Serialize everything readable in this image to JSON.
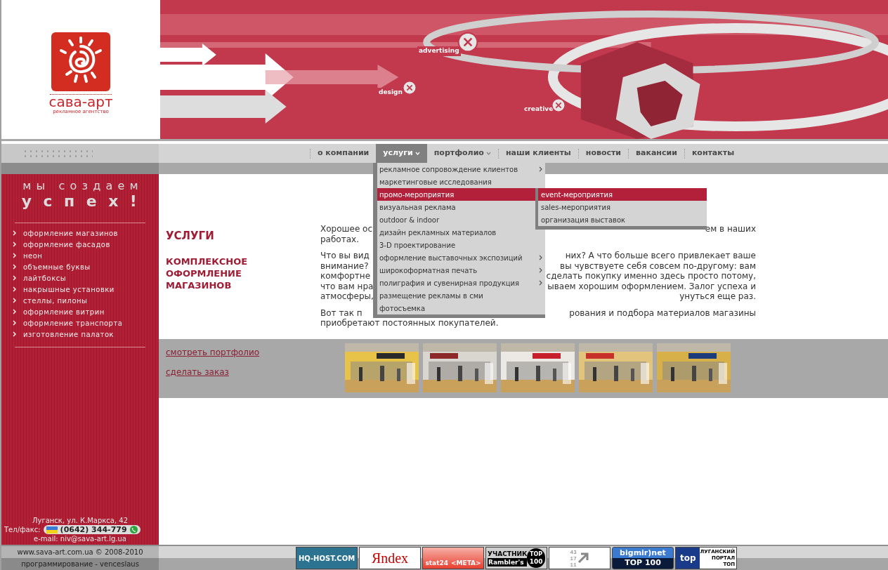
{
  "logo": {
    "name": "сава-арт",
    "tagline": "рекламное агентство"
  },
  "banner": {
    "labels": [
      {
        "text": "advertising"
      },
      {
        "text": "design"
      },
      {
        "text": "creative"
      }
    ]
  },
  "nav": [
    {
      "label": "о компании",
      "selected": false,
      "has_submenu": false
    },
    {
      "label": "услуги",
      "selected": true,
      "has_submenu": true
    },
    {
      "label": "портфолио",
      "selected": false,
      "has_submenu": true
    },
    {
      "label": "наши клиенты",
      "selected": false,
      "has_submenu": false
    },
    {
      "label": "новости",
      "selected": false,
      "has_submenu": false
    },
    {
      "label": "вакансии",
      "selected": false,
      "has_submenu": false
    },
    {
      "label": "контакты",
      "selected": false,
      "has_submenu": false
    }
  ],
  "dropdown": [
    {
      "label": "рекламное сопровождение клиентов",
      "selected": false,
      "has_submenu": true
    },
    {
      "label": "маркетинговые исследования",
      "selected": false,
      "has_submenu": false
    },
    {
      "label": "промо-мероприятия",
      "selected": true,
      "has_submenu": true,
      "children": [
        {
          "label": "event-мероприятия",
          "selected": true
        },
        {
          "label": "sales-мероприятия",
          "selected": false
        },
        {
          "label": "организация выставок",
          "selected": false
        }
      ]
    },
    {
      "label": "визуальная реклама",
      "selected": false,
      "has_submenu": false
    },
    {
      "label": "outdoor & indoor",
      "selected": false,
      "has_submenu": false
    },
    {
      "label": "дизайн рекламных материалов",
      "selected": false,
      "has_submenu": false
    },
    {
      "label": "3-D проектирование",
      "selected": false,
      "has_submenu": false
    },
    {
      "label": "оформление выставочных экспозиций",
      "selected": false,
      "has_submenu": true
    },
    {
      "label": "широкоформатная печать",
      "selected": false,
      "has_submenu": true
    },
    {
      "label": "полиграфия и сувенирная продукция",
      "selected": false,
      "has_submenu": true
    },
    {
      "label": "размещение рекламы в сми",
      "selected": false,
      "has_submenu": false
    },
    {
      "label": "фотосъемка",
      "selected": false,
      "has_submenu": false
    }
  ],
  "sidebar": {
    "slogan_top": "мы создаем",
    "slogan_bottom": "успех!",
    "items": [
      "оформление магазинов",
      "оформление фасадов",
      "неон",
      "объемные буквы",
      "лайтбоксы",
      "накрышные установки",
      "стеллы, пилоны",
      "оформление витрин",
      "оформление транспорта",
      "изготовление палаток"
    ],
    "address": "Луганск, ул. К.Маркса, 42",
    "phone_label": "Тел/факс:",
    "phone": "(0642) 344-779",
    "email": "e-mail: niv@sava-art.lg.ua"
  },
  "page": {
    "title": "УСЛУГИ",
    "subtitle": "КОМПЛЕКСНОЕ ОФОРМЛЕНИЕ МАГАЗИНОВ",
    "paragraphs": [
      [
        [
          "Хорошее ос",
          "ем в наших"
        ],
        [
          "работах."
        ]
      ],
      [
        [
          "Что вы вид",
          "них? А что больше всего привлекает ваше"
        ],
        [
          "внимание?",
          "вы чувствуете себя совсем по-другому: вам"
        ],
        [
          "комфортне",
          "сделать покупку именно здесь просто потому,"
        ],
        [
          "что вам нра",
          "ываем хорошим оформлением. Залог успеха и"
        ],
        [
          "атмосферы,",
          "унуться еще раз."
        ]
      ],
      [
        [
          "Вот так п",
          "рования и подбора материалов магазины"
        ],
        [
          "приобретают постоянных покупателей."
        ]
      ]
    ]
  },
  "links": [
    "смотреть портфолио",
    "сделать заказ"
  ],
  "gallery": [
    {
      "kind": "picture"
    },
    {
      "kind": "picture"
    },
    {
      "kind": "picture"
    },
    {
      "kind": "picture"
    },
    {
      "kind": "picture"
    }
  ],
  "footer": {
    "copyright": "www.sava-art.com.ua © 2008-2010",
    "credits": "программирование - venceslaus",
    "badges": [
      {
        "kind": "hqhost",
        "texts": [
          "HQ-HOST.COM"
        ]
      },
      {
        "kind": "yandex",
        "texts": [
          "Яndex"
        ]
      },
      {
        "kind": "stat24",
        "texts": [
          "stat24",
          "<META>"
        ]
      },
      {
        "kind": "rambler",
        "texts": [
          "УЧАСТНИК",
          "Rambler's",
          "TOP",
          "100"
        ]
      },
      {
        "kind": "counter",
        "texts": [
          "43",
          "17",
          "11"
        ]
      },
      {
        "kind": "bigmir",
        "texts": [
          "bigmir)net",
          "TOP 100"
        ]
      },
      {
        "kind": "lugansk",
        "texts": [
          "top",
          "ЛУГАНСКИЙ",
          "ПОРТАЛ",
          "ТОП"
        ]
      }
    ]
  }
}
